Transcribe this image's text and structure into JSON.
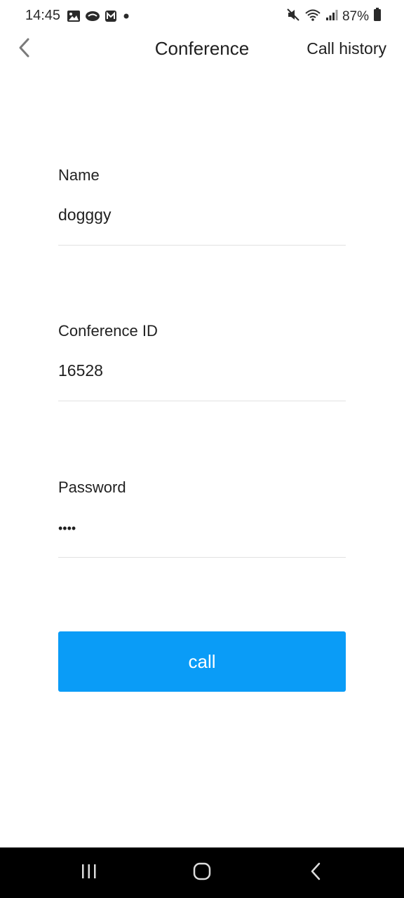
{
  "status_bar": {
    "time": "14:45",
    "battery": "87%",
    "left_icons": [
      "gallery-icon",
      "cloud-app-icon",
      "app-m-icon",
      "dot-icon"
    ],
    "right_icons": [
      "mute-icon",
      "wifi-icon",
      "signal-icon",
      "battery-icon"
    ]
  },
  "header": {
    "title": "Conference",
    "call_history": "Call history"
  },
  "form": {
    "name": {
      "label": "Name",
      "value": "dogggy"
    },
    "conference_id": {
      "label": "Conference ID",
      "value": "16528"
    },
    "password": {
      "label": "Password",
      "value_masked": "••••"
    }
  },
  "call_button": {
    "label": "call"
  },
  "colors": {
    "accent": "#0a9cf7",
    "divider": "#e2e2e2",
    "text": "#1f1f1f",
    "nav_bar": "#000000"
  }
}
